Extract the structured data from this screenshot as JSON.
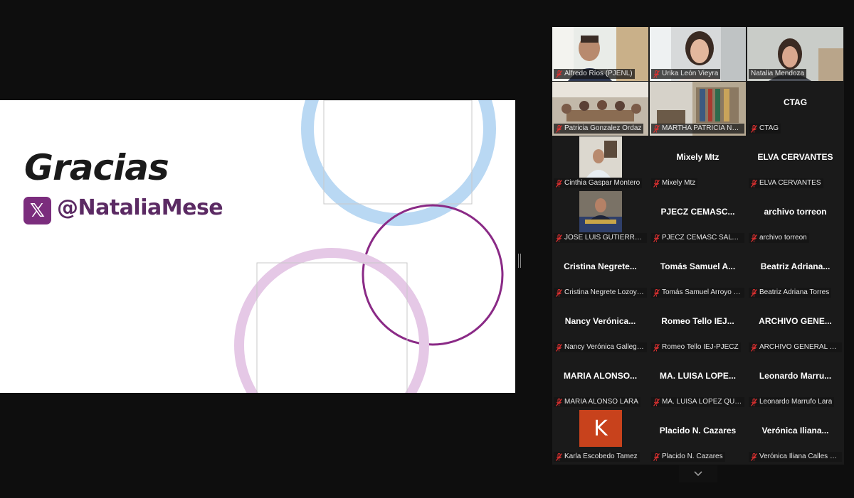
{
  "slide": {
    "title": "Gracias",
    "logo_letter": "𝕏",
    "handle": "@NataliaMese"
  },
  "colors": {
    "background": "#0e0e0e",
    "active_speaker": "#23d959",
    "brand_purple": "#7b2d7d",
    "muted_icon": "#e03030",
    "avatar_k": "#c8421c"
  },
  "participants": [
    {
      "name": "Alfredo Ríos (PJENL)",
      "video": true,
      "muted": true
    },
    {
      "name": "Urika León Vieyra",
      "video": true,
      "muted": true
    },
    {
      "name": "Natalia Mendoza",
      "video": true,
      "muted": false,
      "active": true
    },
    {
      "name": "Patricia Gonzalez Ordaz",
      "video": true,
      "muted": true
    },
    {
      "name": "MARTHA PATRICIA NUÑ...",
      "video": true,
      "muted": true
    },
    {
      "name": "CTAG",
      "display": "CTAG",
      "video": false,
      "muted": true
    },
    {
      "name": "Cinthia Gaspar Montero",
      "video": true,
      "muted": true
    },
    {
      "name": "Mixely Mtz",
      "display": "Mixely Mtz",
      "video": false,
      "muted": true
    },
    {
      "name": "ELVA CERVANTES",
      "display": "ELVA CERVANTES",
      "video": false,
      "muted": true
    },
    {
      "name": "JOSE LUIS GUTIERREZ R...",
      "video": true,
      "muted": true
    },
    {
      "name": "PJECZ CEMASC SALTILLO",
      "display": "PJECZ  CEMASC...",
      "video": false,
      "muted": true
    },
    {
      "name": "archivo torreon",
      "display": "archivo torreon",
      "video": false,
      "muted": true
    },
    {
      "name": "Cristina Negrete Lozoya...",
      "display": "Cristina  Negrete...",
      "video": false,
      "muted": true
    },
    {
      "name": "Tomás Samuel Arroyo H...",
      "display": "Tomás Samuel A...",
      "video": false,
      "muted": true
    },
    {
      "name": "Beatriz Adriana Torres",
      "display": "Beatriz  Adriana...",
      "video": false,
      "muted": true
    },
    {
      "name": "Nancy Verónica Gallego...",
      "display": "Nancy  Verónica...",
      "video": false,
      "muted": true
    },
    {
      "name": "Romeo Tello IEJ-PJECZ",
      "display": "Romeo Tello IEJ...",
      "video": false,
      "muted": true
    },
    {
      "name": "ARCHIVO GENERAL PJECZ",
      "display": "ARCHIVO  GENE...",
      "video": false,
      "muted": true
    },
    {
      "name": "MARIA ALONSO LARA",
      "display": "MARIA  ALONSO...",
      "video": false,
      "muted": true
    },
    {
      "name": "MA. LUISA LOPEZ QUIN...",
      "display": "MA.  LUISA  LOPE...",
      "video": false,
      "muted": true
    },
    {
      "name": "Leonardo Marrufo Lara",
      "display": "Leonardo  Marru...",
      "video": false,
      "muted": true
    },
    {
      "name": "Karla Escobedo Tamez",
      "avatar": "K",
      "video": false,
      "muted": true
    },
    {
      "name": "Placido N. Cazares",
      "display": "Placido N. Cazares",
      "video": false,
      "muted": true
    },
    {
      "name": "Verónica Iliana Calles Ca...",
      "display": "Verónica  Iliana...",
      "video": false,
      "muted": true
    }
  ],
  "icons": {
    "muted": "mic-muted-icon",
    "scroll": "chevron-down-icon"
  }
}
